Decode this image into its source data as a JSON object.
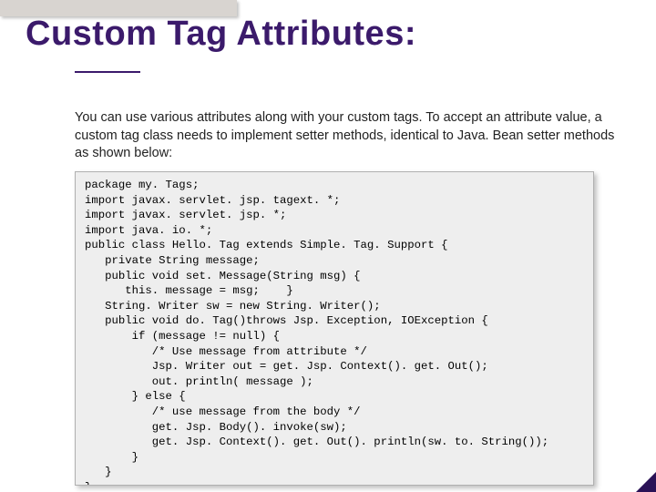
{
  "title": "Custom Tag Attributes:",
  "body": "You can use various attributes along with your custom tags. To accept an attribute value, a custom tag class needs to implement setter methods, identical to Java. Bean setter methods as shown below:",
  "code": "package my. Tags;\nimport javax. servlet. jsp. tagext. *;\nimport javax. servlet. jsp. *;\nimport java. io. *;\npublic class Hello. Tag extends Simple. Tag. Support {\n   private String message;\n   public void set. Message(String msg) {\n      this. message = msg;    }\n   String. Writer sw = new String. Writer();\n   public void do. Tag()throws Jsp. Exception, IOException {\n       if (message != null) {\n          /* Use message from attribute */\n          Jsp. Writer out = get. Jsp. Context(). get. Out();\n          out. println( message );\n       } else {\n          /* use message from the body */\n          get. Jsp. Body(). invoke(sw);\n          get. Jsp. Context(). get. Out(). println(sw. to. String());\n       }\n   }\n}"
}
